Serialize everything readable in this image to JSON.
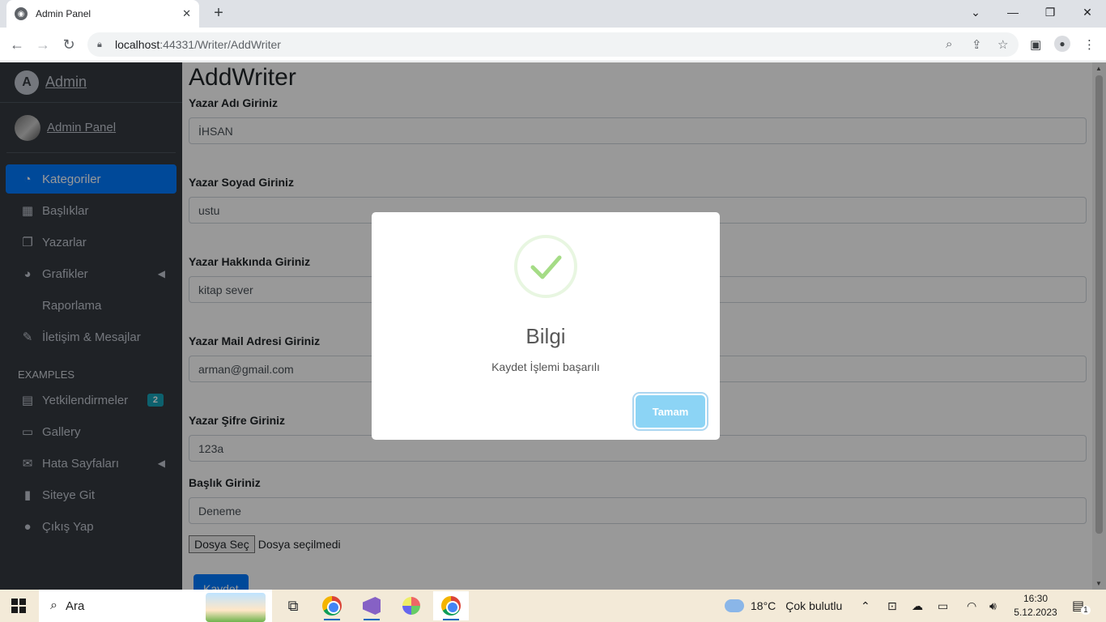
{
  "browser": {
    "tab_title": "Admin Panel",
    "url_host": "localhost",
    "url_path": ":44331/Writer/AddWriter"
  },
  "sidebar": {
    "brand": "Admin",
    "user": "Admin Panel",
    "items": [
      {
        "label": "Kategoriler",
        "icon": "dashboard-icon",
        "active": true
      },
      {
        "label": "Başlıklar",
        "icon": "grid-icon"
      },
      {
        "label": "Yazarlar",
        "icon": "copy-icon"
      },
      {
        "label": "Grafikler",
        "icon": "pie-chart-icon",
        "chevron": true
      },
      {
        "label": "Raporlama"
      },
      {
        "label": "İletişim & Mesajlar",
        "icon": "edit-icon"
      }
    ],
    "section_header": "EXAMPLES",
    "examples": [
      {
        "label": "Yetkilendirmeler",
        "icon": "calendar-icon",
        "badge": "2"
      },
      {
        "label": "Gallery",
        "icon": "image-icon"
      },
      {
        "label": "Hata Sayfaları",
        "icon": "envelope-icon",
        "chevron": true
      },
      {
        "label": "Siteye Git",
        "icon": "book-icon"
      },
      {
        "label": "Çıkış Yap",
        "icon": "apple-icon"
      }
    ]
  },
  "form": {
    "title": "AddWriter",
    "fields": [
      {
        "label": "Yazar Adı Giriniz",
        "value": "İHSAN"
      },
      {
        "label": "Yazar Soyad Giriniz",
        "value": "ustu"
      },
      {
        "label": "Yazar Hakkında Giriniz",
        "value": "kitap sever"
      },
      {
        "label": "Yazar Mail Adresi Giriniz",
        "value": "arman@gmail.com"
      },
      {
        "label": "Yazar Şifre Giriniz",
        "value": "123a"
      },
      {
        "label": "Başlık Giriniz",
        "value": "Deneme"
      }
    ],
    "file_button": "Dosya Seç",
    "file_status": "Dosya seçilmedi",
    "submit": "Kaydet"
  },
  "modal": {
    "title": "Bilgi",
    "text": "Kaydet İşlemi başarılı",
    "ok": "Tamam"
  },
  "taskbar": {
    "search": "Ara",
    "weather_temp": "18°C",
    "weather_text": "Çok bulutlu",
    "time": "16:30",
    "date": "5.12.2023",
    "notifications": "1"
  }
}
